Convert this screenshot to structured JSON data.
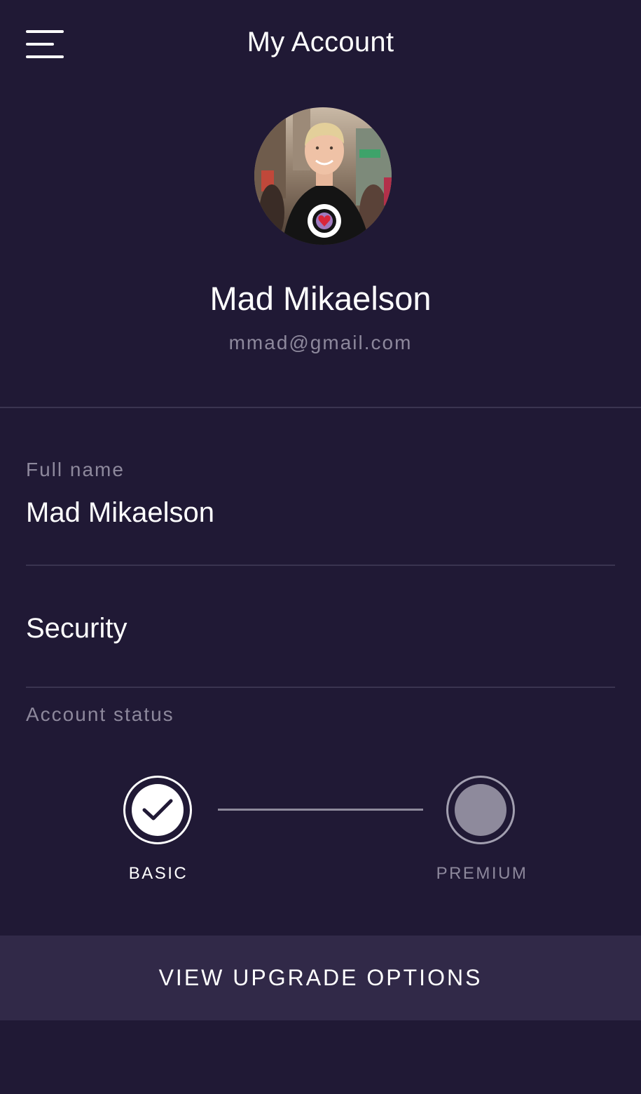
{
  "header": {
    "title": "My Account",
    "menu_icon": "hamburger-menu-icon"
  },
  "profile": {
    "name": "Mad Mikaelson",
    "email": "mmad@gmail.com"
  },
  "fields": {
    "full_name_label": "Full name",
    "full_name_value": "Mad Mikaelson",
    "security_label": "Security",
    "account_status_label": "Account status"
  },
  "status": {
    "steps": [
      {
        "label": "BASIC",
        "state": "completed"
      },
      {
        "label": "PREMIUM",
        "state": "inactive"
      }
    ]
  },
  "upgrade_button": {
    "label": "VIEW UPGRADE OPTIONS"
  },
  "colors": {
    "background": "#201935",
    "button_background": "#312948",
    "muted_text": "#8d889c",
    "divider": "#3a3450"
  }
}
